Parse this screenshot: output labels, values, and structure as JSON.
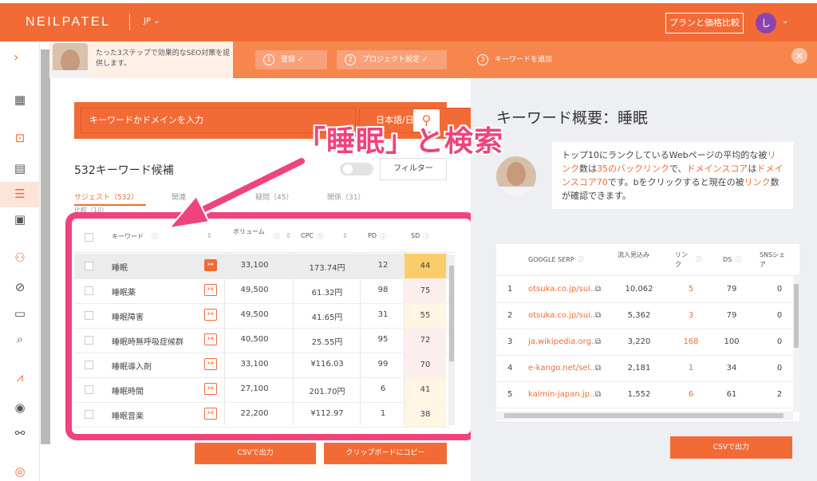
{
  "header": {
    "logo": "NEILPATEL",
    "lang": "JP",
    "plan_button": "プランと価格比較",
    "avatar_initial": "し"
  },
  "guide": {
    "message": "たった3ステップで効果的なSEO対策を提供します。",
    "steps": [
      {
        "num": "1",
        "label": "登録 ✓"
      },
      {
        "num": "2",
        "label": "プロジェクト設定 ✓"
      },
      {
        "num": "3",
        "label": "キーワードを追加"
      }
    ]
  },
  "search": {
    "placeholder": "キーワードかドメインを入力",
    "language": "日本語/日本"
  },
  "annotation": "「睡眠」と検索",
  "keywords": {
    "count_label": "532キーワード候補",
    "filter_label": "フィルター",
    "tabs": [
      "サジェスト（532）",
      "関連",
      "疑問（45）",
      "関係（31）"
    ],
    "tab_sub": "比較（10）",
    "headers": {
      "keyword": "キーワード",
      "volume": "ボリューム",
      "cpc": "CPC",
      "pd": "PD",
      "sd": "SD"
    },
    "rows": [
      {
        "keyword": "睡眠",
        "volume": "33,100",
        "cpc": "173.74円",
        "pd": "12",
        "sd": "44",
        "sd_color": "#f9cd69"
      },
      {
        "keyword": "睡眠薬",
        "volume": "49,500",
        "cpc": "61.32円",
        "pd": "98",
        "sd": "75",
        "sd_color": "#fdeeee"
      },
      {
        "keyword": "睡眠障害",
        "volume": "49,500",
        "cpc": "41.65円",
        "pd": "31",
        "sd": "55",
        "sd_color": "#fef5e3"
      },
      {
        "keyword": "睡眠時無呼吸症候群",
        "volume": "40,500",
        "cpc": "25.55円",
        "pd": "95",
        "sd": "72",
        "sd_color": "#fdeeee"
      },
      {
        "keyword": "睡眠導入剤",
        "volume": "33,100",
        "cpc": "¥116.03",
        "pd": "99",
        "sd": "70",
        "sd_color": "#fdeeee"
      },
      {
        "keyword": "睡眠時間",
        "volume": "27,100",
        "cpc": "201.70円",
        "pd": "6",
        "sd": "41",
        "sd_color": "#fef5e3"
      },
      {
        "keyword": "睡眠音楽",
        "volume": "22,200",
        "cpc": "¥112.97",
        "pd": "1",
        "sd": "38",
        "sd_color": "#fef5e3"
      }
    ],
    "csv_button": "CSVで出力",
    "copy_button": "クリップボードにコピー"
  },
  "overview": {
    "title": "キーワード概要：睡眠",
    "bubble_parts": [
      {
        "t": "トップ10にランクしているWebページの平均的な被",
        "o": false
      },
      {
        "t": "リンク",
        "o": true
      },
      {
        "t": "数は",
        "o": false
      },
      {
        "t": "35のバックリンク",
        "o": true
      },
      {
        "t": "で、",
        "o": false
      },
      {
        "t": "ドメインスコア",
        "o": true
      },
      {
        "t": "は",
        "o": false
      },
      {
        "t": "ドメインスコア70",
        "o": true
      },
      {
        "t": "です。bをクリックすると現在の被",
        "o": false
      },
      {
        "t": "リンク",
        "o": true
      },
      {
        "t": "数が確認できます。",
        "o": false
      }
    ],
    "serp_headers": {
      "serp": "GOOGLE SERP",
      "traffic": "流入見込み",
      "links": "リンク",
      "ds": "DS",
      "sns": "SNSシェア"
    },
    "serp_rows": [
      {
        "rank": "1",
        "url": "otsuka.co.jp/sui...",
        "traffic": "10,062",
        "links": "5",
        "ds": "79",
        "sns": "0"
      },
      {
        "rank": "2",
        "url": "otsuka.co.jp/sui...",
        "traffic": "5,362",
        "links": "3",
        "ds": "79",
        "sns": "0"
      },
      {
        "rank": "3",
        "url": "ja.wikipedia.org...",
        "traffic": "3,220",
        "links": "168",
        "ds": "100",
        "sns": "0"
      },
      {
        "rank": "4",
        "url": "e-kango.net/sel...",
        "traffic": "2,181",
        "links": "1",
        "ds": "34",
        "sns": "0"
      },
      {
        "rank": "5",
        "url": "kaimin-japan.jp...",
        "traffic": "1,552",
        "links": "6",
        "ds": "61",
        "sns": "2"
      }
    ],
    "csv_button": "CSVで出力"
  },
  "colors": {
    "brand": "#f26b36",
    "highlight": "#f0437c"
  }
}
